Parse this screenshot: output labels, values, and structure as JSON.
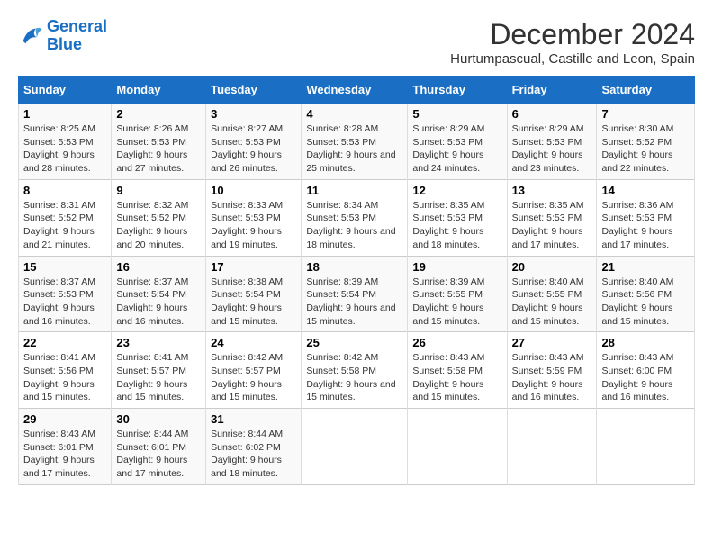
{
  "logo": {
    "line1": "General",
    "line2": "Blue"
  },
  "title": "December 2024",
  "subtitle": "Hurtumpascual, Castille and Leon, Spain",
  "days_of_week": [
    "Sunday",
    "Monday",
    "Tuesday",
    "Wednesday",
    "Thursday",
    "Friday",
    "Saturday"
  ],
  "weeks": [
    [
      {
        "day": "1",
        "sunrise": "Sunrise: 8:25 AM",
        "sunset": "Sunset: 5:53 PM",
        "daylight": "Daylight: 9 hours and 28 minutes."
      },
      {
        "day": "2",
        "sunrise": "Sunrise: 8:26 AM",
        "sunset": "Sunset: 5:53 PM",
        "daylight": "Daylight: 9 hours and 27 minutes."
      },
      {
        "day": "3",
        "sunrise": "Sunrise: 8:27 AM",
        "sunset": "Sunset: 5:53 PM",
        "daylight": "Daylight: 9 hours and 26 minutes."
      },
      {
        "day": "4",
        "sunrise": "Sunrise: 8:28 AM",
        "sunset": "Sunset: 5:53 PM",
        "daylight": "Daylight: 9 hours and 25 minutes."
      },
      {
        "day": "5",
        "sunrise": "Sunrise: 8:29 AM",
        "sunset": "Sunset: 5:53 PM",
        "daylight": "Daylight: 9 hours and 24 minutes."
      },
      {
        "day": "6",
        "sunrise": "Sunrise: 8:29 AM",
        "sunset": "Sunset: 5:53 PM",
        "daylight": "Daylight: 9 hours and 23 minutes."
      },
      {
        "day": "7",
        "sunrise": "Sunrise: 8:30 AM",
        "sunset": "Sunset: 5:52 PM",
        "daylight": "Daylight: 9 hours and 22 minutes."
      }
    ],
    [
      {
        "day": "8",
        "sunrise": "Sunrise: 8:31 AM",
        "sunset": "Sunset: 5:52 PM",
        "daylight": "Daylight: 9 hours and 21 minutes."
      },
      {
        "day": "9",
        "sunrise": "Sunrise: 8:32 AM",
        "sunset": "Sunset: 5:52 PM",
        "daylight": "Daylight: 9 hours and 20 minutes."
      },
      {
        "day": "10",
        "sunrise": "Sunrise: 8:33 AM",
        "sunset": "Sunset: 5:53 PM",
        "daylight": "Daylight: 9 hours and 19 minutes."
      },
      {
        "day": "11",
        "sunrise": "Sunrise: 8:34 AM",
        "sunset": "Sunset: 5:53 PM",
        "daylight": "Daylight: 9 hours and 18 minutes."
      },
      {
        "day": "12",
        "sunrise": "Sunrise: 8:35 AM",
        "sunset": "Sunset: 5:53 PM",
        "daylight": "Daylight: 9 hours and 18 minutes."
      },
      {
        "day": "13",
        "sunrise": "Sunrise: 8:35 AM",
        "sunset": "Sunset: 5:53 PM",
        "daylight": "Daylight: 9 hours and 17 minutes."
      },
      {
        "day": "14",
        "sunrise": "Sunrise: 8:36 AM",
        "sunset": "Sunset: 5:53 PM",
        "daylight": "Daylight: 9 hours and 17 minutes."
      }
    ],
    [
      {
        "day": "15",
        "sunrise": "Sunrise: 8:37 AM",
        "sunset": "Sunset: 5:53 PM",
        "daylight": "Daylight: 9 hours and 16 minutes."
      },
      {
        "day": "16",
        "sunrise": "Sunrise: 8:37 AM",
        "sunset": "Sunset: 5:54 PM",
        "daylight": "Daylight: 9 hours and 16 minutes."
      },
      {
        "day": "17",
        "sunrise": "Sunrise: 8:38 AM",
        "sunset": "Sunset: 5:54 PM",
        "daylight": "Daylight: 9 hours and 15 minutes."
      },
      {
        "day": "18",
        "sunrise": "Sunrise: 8:39 AM",
        "sunset": "Sunset: 5:54 PM",
        "daylight": "Daylight: 9 hours and 15 minutes."
      },
      {
        "day": "19",
        "sunrise": "Sunrise: 8:39 AM",
        "sunset": "Sunset: 5:55 PM",
        "daylight": "Daylight: 9 hours and 15 minutes."
      },
      {
        "day": "20",
        "sunrise": "Sunrise: 8:40 AM",
        "sunset": "Sunset: 5:55 PM",
        "daylight": "Daylight: 9 hours and 15 minutes."
      },
      {
        "day": "21",
        "sunrise": "Sunrise: 8:40 AM",
        "sunset": "Sunset: 5:56 PM",
        "daylight": "Daylight: 9 hours and 15 minutes."
      }
    ],
    [
      {
        "day": "22",
        "sunrise": "Sunrise: 8:41 AM",
        "sunset": "Sunset: 5:56 PM",
        "daylight": "Daylight: 9 hours and 15 minutes."
      },
      {
        "day": "23",
        "sunrise": "Sunrise: 8:41 AM",
        "sunset": "Sunset: 5:57 PM",
        "daylight": "Daylight: 9 hours and 15 minutes."
      },
      {
        "day": "24",
        "sunrise": "Sunrise: 8:42 AM",
        "sunset": "Sunset: 5:57 PM",
        "daylight": "Daylight: 9 hours and 15 minutes."
      },
      {
        "day": "25",
        "sunrise": "Sunrise: 8:42 AM",
        "sunset": "Sunset: 5:58 PM",
        "daylight": "Daylight: 9 hours and 15 minutes."
      },
      {
        "day": "26",
        "sunrise": "Sunrise: 8:43 AM",
        "sunset": "Sunset: 5:58 PM",
        "daylight": "Daylight: 9 hours and 15 minutes."
      },
      {
        "day": "27",
        "sunrise": "Sunrise: 8:43 AM",
        "sunset": "Sunset: 5:59 PM",
        "daylight": "Daylight: 9 hours and 16 minutes."
      },
      {
        "day": "28",
        "sunrise": "Sunrise: 8:43 AM",
        "sunset": "Sunset: 6:00 PM",
        "daylight": "Daylight: 9 hours and 16 minutes."
      }
    ],
    [
      {
        "day": "29",
        "sunrise": "Sunrise: 8:43 AM",
        "sunset": "Sunset: 6:01 PM",
        "daylight": "Daylight: 9 hours and 17 minutes."
      },
      {
        "day": "30",
        "sunrise": "Sunrise: 8:44 AM",
        "sunset": "Sunset: 6:01 PM",
        "daylight": "Daylight: 9 hours and 17 minutes."
      },
      {
        "day": "31",
        "sunrise": "Sunrise: 8:44 AM",
        "sunset": "Sunset: 6:02 PM",
        "daylight": "Daylight: 9 hours and 18 minutes."
      },
      null,
      null,
      null,
      null
    ]
  ]
}
